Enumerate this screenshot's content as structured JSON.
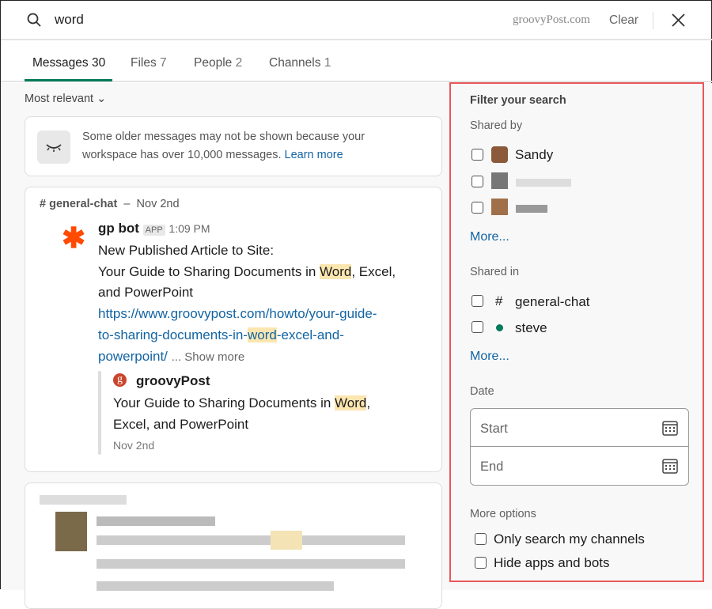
{
  "search": {
    "query": "word",
    "watermark": "groovyPost.com",
    "clear_label": "Clear"
  },
  "tabs": [
    {
      "label": "Messages",
      "count": "30"
    },
    {
      "label": "Files",
      "count": "7"
    },
    {
      "label": "People",
      "count": "2"
    },
    {
      "label": "Channels",
      "count": "1"
    }
  ],
  "sort": {
    "label": "Most relevant"
  },
  "notice": {
    "text": "Some older messages may not be shown because your workspace has over 10,000 messages.",
    "link": "Learn more"
  },
  "message": {
    "channel": "# general-chat",
    "dash": "–",
    "date": "Nov 2nd",
    "author": "gp bot",
    "badge": "APP",
    "time": "1:09 PM",
    "line1": "New Published Article to Site:",
    "line2a": "Your Guide to Sharing Documents in ",
    "hl": "Word",
    "line2b": ", Excel,",
    "line3": "and PowerPoint",
    "url1": "https://www.groovypost.com/howto/your-guide-",
    "url2a": "to-sharing-documents-in-",
    "url_hl": "word",
    "url2b": "-excel-and-",
    "url3": "powerpoint/",
    "show_more": "... Show more",
    "attachment": {
      "source": "groovyPost",
      "t1a": "Your Guide to Sharing Documents in ",
      "t1hl": "Word",
      "t1b": ",",
      "t2": "Excel, and PowerPoint",
      "date": "Nov 2nd"
    }
  },
  "filter": {
    "title": "Filter your search",
    "shared_by_label": "Shared by",
    "shared_by": [
      "Sandy"
    ],
    "more1": "More...",
    "shared_in_label": "Shared in",
    "shared_in": [
      {
        "name": "general-chat",
        "icon": "hash"
      },
      {
        "name": "steve",
        "icon": "online-dot"
      }
    ],
    "more2": "More...",
    "date_label": "Date",
    "start": "Start",
    "end": "End",
    "more_options_label": "More options",
    "options": [
      "Only search my channels",
      "Hide apps and bots"
    ]
  },
  "colors": {
    "accent": "#007a5a",
    "highlight_border": "#e8585a",
    "link": "#1264a3"
  }
}
